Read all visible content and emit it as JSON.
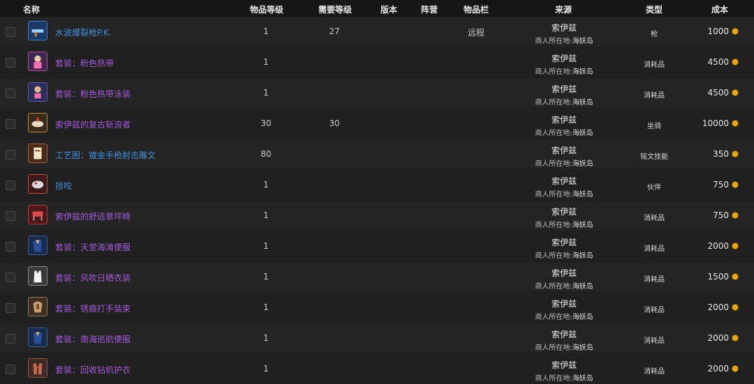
{
  "header": {
    "name": "名称",
    "item_level": "物品等级",
    "req_level": "需要等级",
    "version": "版本",
    "faction": "阵营",
    "slot": "物品栏",
    "source": "来源",
    "type": "类型",
    "cost": "成本"
  },
  "rows": [
    {
      "name": "水波爆裂枪P.K.",
      "color": "blue",
      "item_level": "1",
      "req_level": "27",
      "slot": "远程",
      "npc": "索伊兹",
      "loc_label": "商人所在地:",
      "loc": "海妖岛",
      "type": "枪",
      "cost": "1000",
      "icon": "gun-icon"
    },
    {
      "name": "套装：粉色热带",
      "color": "purple",
      "item_level": "1",
      "req_level": "",
      "slot": "",
      "npc": "索伊兹",
      "loc_label": "商人所在地:",
      "loc": "海妖岛",
      "type": "消耗品",
      "cost": "4500",
      "icon": "costume-icon"
    },
    {
      "name": "套装：粉色热带泳装",
      "color": "purple",
      "item_level": "1",
      "req_level": "",
      "slot": "",
      "npc": "索伊兹",
      "loc_label": "商人所在地:",
      "loc": "海妖岛",
      "type": "消耗品",
      "cost": "4500",
      "icon": "swimsuit-icon"
    },
    {
      "name": "索伊兹的复古斩浪者",
      "color": "purple",
      "item_level": "30",
      "req_level": "30",
      "slot": "",
      "npc": "索伊兹",
      "loc_label": "商人所在地:",
      "loc": "海妖岛",
      "type": "坐骑",
      "cost": "10000",
      "icon": "mount-icon"
    },
    {
      "name": "工艺图：镀金手枪射击雕文",
      "color": "blue",
      "item_level": "80",
      "req_level": "",
      "slot": "",
      "npc": "索伊兹",
      "loc_label": "商人所在地:",
      "loc": "海妖岛",
      "type": "铭文技能",
      "cost": "350",
      "icon": "scroll-icon"
    },
    {
      "name": "掠咬",
      "color": "blue",
      "item_level": "1",
      "req_level": "",
      "slot": "",
      "npc": "索伊兹",
      "loc_label": "商人所在地:",
      "loc": "海妖岛",
      "type": "伙伴",
      "cost": "750",
      "icon": "pet-icon"
    },
    {
      "name": "索伊兹的舒适草坪椅",
      "color": "purple",
      "item_level": "1",
      "req_level": "",
      "slot": "",
      "npc": "索伊兹",
      "loc_label": "商人所在地:",
      "loc": "海妖岛",
      "type": "消耗品",
      "cost": "750",
      "icon": "chair-icon"
    },
    {
      "name": "套装：天堂海滩便服",
      "color": "purple",
      "item_level": "1",
      "req_level": "",
      "slot": "",
      "npc": "索伊兹",
      "loc_label": "商人所在地:",
      "loc": "海妖岛",
      "type": "消耗品",
      "cost": "2000",
      "icon": "shirt-icon"
    },
    {
      "name": "套装：风吹日晒衣装",
      "color": "purple",
      "item_level": "1",
      "req_level": "",
      "slot": "",
      "npc": "索伊兹",
      "loc_label": "商人所在地:",
      "loc": "海妖岛",
      "type": "消耗品",
      "cost": "1500",
      "icon": "tank-top-icon"
    },
    {
      "name": "套装：锈痕打手装束",
      "color": "purple",
      "item_level": "1",
      "req_level": "",
      "slot": "",
      "npc": "索伊兹",
      "loc_label": "商人所在地:",
      "loc": "海妖岛",
      "type": "消耗品",
      "cost": "2000",
      "icon": "armor-icon"
    },
    {
      "name": "套装：南海巡航便服",
      "color": "purple",
      "item_level": "1",
      "req_level": "",
      "slot": "",
      "npc": "索伊兹",
      "loc_label": "商人所在地:",
      "loc": "海妖岛",
      "type": "消耗品",
      "cost": "2000",
      "icon": "shirt-icon"
    },
    {
      "name": "套装：回收钻机护衣",
      "color": "purple",
      "item_level": "1",
      "req_level": "",
      "slot": "",
      "npc": "索伊兹",
      "loc_label": "商人所在地:",
      "loc": "海妖岛",
      "type": "消耗品",
      "cost": "2000",
      "icon": "vest-icon"
    }
  ],
  "colors": {
    "link_blue": "#3f8fd8",
    "link_purple": "#a35ad8",
    "coin": "#e5a91a"
  }
}
